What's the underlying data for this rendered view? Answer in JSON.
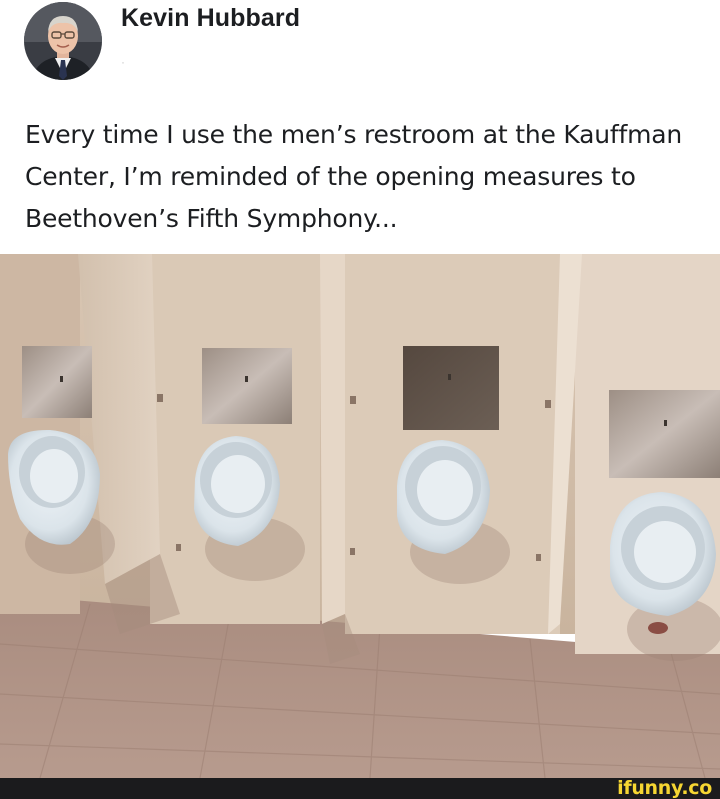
{
  "post": {
    "author_name": "Kevin Hubbard",
    "meta": "·",
    "text": "Every time I use the men’s restroom at the Kauffman Center, I’m reminded of the opening measures to Beethoven’s Fifth Symphony...",
    "photo_alt": "restroom-photo"
  },
  "footer": {
    "watermark": "ifunny.co"
  },
  "colors": {
    "text": "#1c1e21",
    "footer_bg": "#1b1b1d",
    "watermark": "#f6d632"
  }
}
